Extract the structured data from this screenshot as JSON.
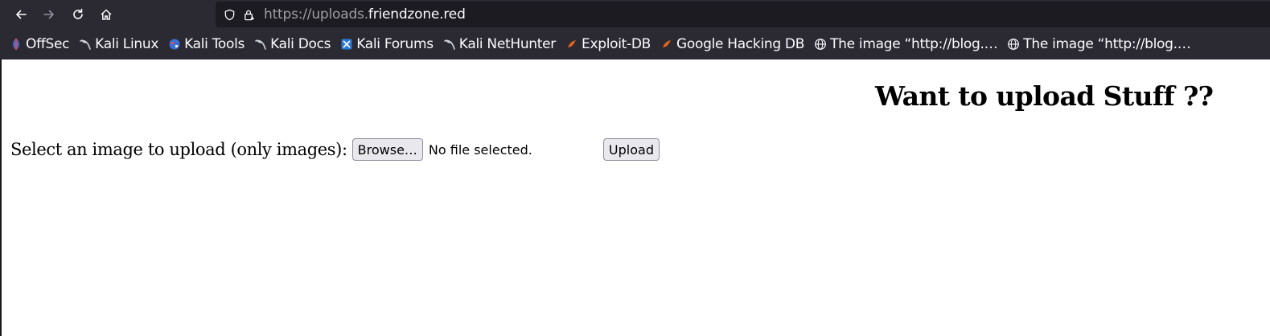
{
  "browser": {
    "url_prefix": "https://uploads.",
    "url_domain": "friendzone.red",
    "bookmarks": [
      {
        "label": "OffSec",
        "icon": "offsec-icon"
      },
      {
        "label": "Kali Linux",
        "icon": "kali-dragon-icon"
      },
      {
        "label": "Kali Tools",
        "icon": "kali-tools-icon"
      },
      {
        "label": "Kali Docs",
        "icon": "kali-dragon-icon"
      },
      {
        "label": "Kali Forums",
        "icon": "kali-forums-icon"
      },
      {
        "label": "Kali NetHunter",
        "icon": "kali-dragon-icon"
      },
      {
        "label": "Exploit-DB",
        "icon": "exploit-db-icon"
      },
      {
        "label": "Google Hacking DB",
        "icon": "exploit-db-icon"
      },
      {
        "label": "The image “http://blog.…",
        "icon": "globe-icon"
      },
      {
        "label": "The image “http://blog.…",
        "icon": "globe-icon"
      }
    ]
  },
  "page": {
    "title": "Want to upload Stuff ??",
    "form_label": "Select an image to upload (only images):",
    "browse_label": "Browse…",
    "file_status": "No file selected.",
    "upload_label": "Upload"
  }
}
